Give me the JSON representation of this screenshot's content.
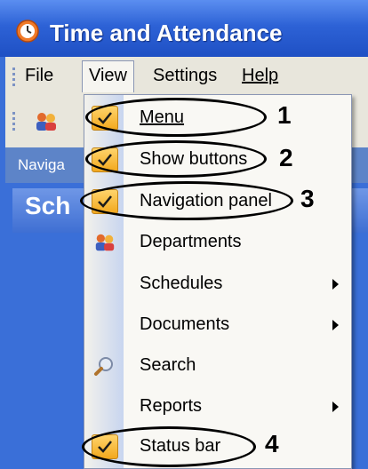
{
  "window": {
    "title": "Time and Attendance"
  },
  "menubar": {
    "items": [
      "File",
      "View",
      "Settings",
      "Help"
    ]
  },
  "nav": {
    "title": "Naviga"
  },
  "section": {
    "title": "Sch"
  },
  "dropdown": {
    "items": [
      {
        "label": "Menu",
        "checked": true,
        "icon": "check-icon"
      },
      {
        "label": "Show buttons",
        "checked": true,
        "icon": "check-icon"
      },
      {
        "label": "Navigation panel",
        "checked": true,
        "icon": "check-icon"
      },
      {
        "label": "Departments",
        "icon": "departments-icon"
      },
      {
        "label": "Schedules",
        "submenu": true
      },
      {
        "label": "Documents",
        "submenu": true
      },
      {
        "label": "Search",
        "icon": "search-icon"
      },
      {
        "label": "Reports",
        "submenu": true
      },
      {
        "label": "Status bar",
        "checked": true,
        "icon": "check-icon"
      }
    ]
  },
  "annotations": [
    "1",
    "2",
    "3",
    "4"
  ]
}
